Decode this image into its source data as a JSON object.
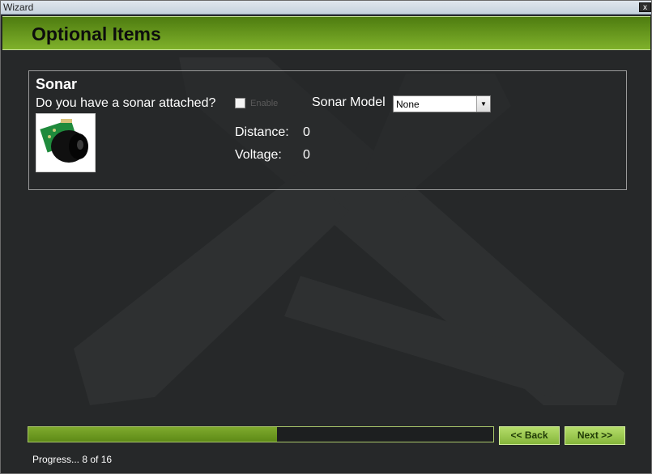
{
  "window": {
    "title": "Wizard",
    "close_label": "x"
  },
  "header": {
    "title": "Optional Items"
  },
  "sonar": {
    "title": "Sonar",
    "question": "Do you have a sonar attached?",
    "enable_label": "Enable",
    "enable_checked": false,
    "model_label": "Sonar Model",
    "model_value": "None",
    "distance_label": "Distance:",
    "distance_value": "0",
    "voltage_label": "Voltage:",
    "voltage_value": "0"
  },
  "footer": {
    "progress_fraction": 0.535,
    "back_label": "<< Back",
    "next_label": "Next >>",
    "progress_text": "Progress... 8 of 16"
  },
  "colors": {
    "accent": "#7fb12b",
    "background": "#262829"
  }
}
